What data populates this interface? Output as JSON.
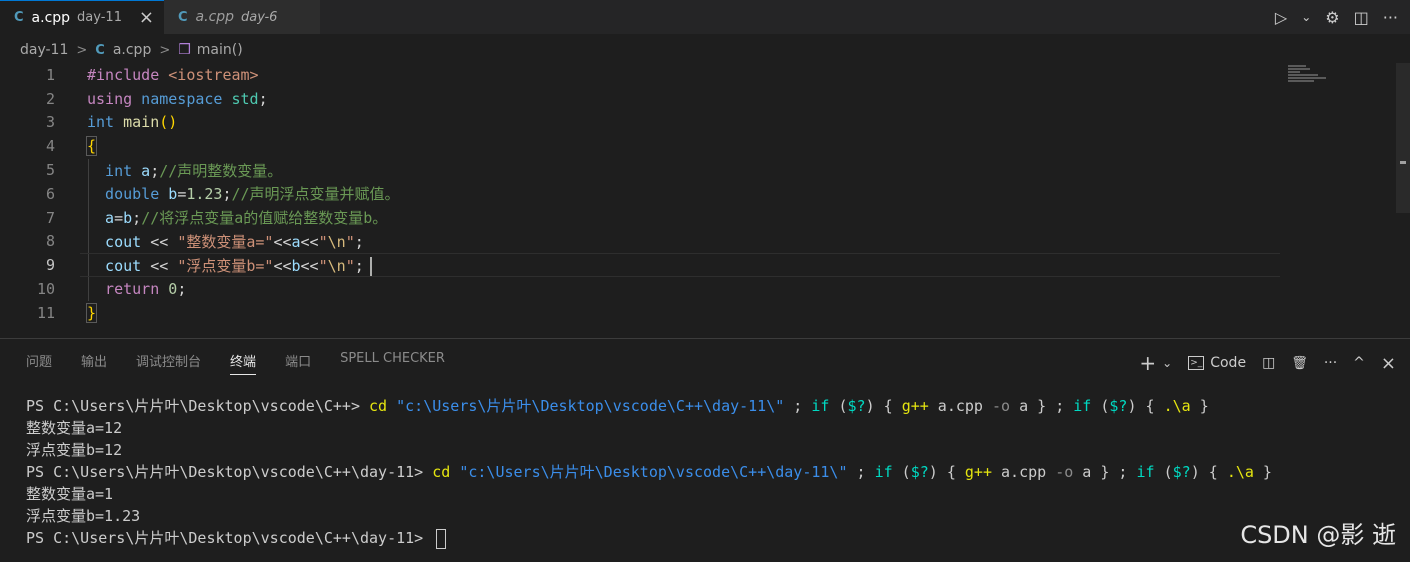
{
  "tabs": [
    {
      "icon": "C",
      "name": "a.cpp",
      "dir": "day-11",
      "close": "×"
    },
    {
      "icon": "C",
      "name": "a.cpp",
      "dir": "day-6"
    }
  ],
  "tab_actions": {
    "run": "▷",
    "run_menu": "⌄",
    "settings": "⚙",
    "split": "◫",
    "more": "···"
  },
  "breadcrumb": {
    "folder": "day-11",
    "file": "a.cpp",
    "symbol": "main()"
  },
  "editor": {
    "line_numbers": [
      "1",
      "2",
      "3",
      "4",
      "5",
      "6",
      "7",
      "8",
      "9",
      "10",
      "11"
    ],
    "current_line": "9",
    "l1": {
      "directive": "#include",
      "header": " <iostream>"
    },
    "l2": {
      "using": "using",
      "namespace": " namespace",
      "std": " std",
      "semi": ";"
    },
    "l3": {
      "type": "int",
      "fn": " main",
      "paren": "()"
    },
    "l4": {
      "brace": "{"
    },
    "l5": {
      "type": "  int",
      "var": " a",
      "semi": ";",
      "comment": "//声明整数变量。"
    },
    "l6": {
      "type": "  double",
      "var": " b",
      "op": "=",
      "num": "1.23",
      "semi": ";",
      "comment": "//声明浮点变量并赋值。"
    },
    "l7": {
      "var": "  a",
      "op": "=",
      "var2": "b",
      "semi": ";",
      "comment": "//将浮点变量a的值赋给整数变量b。"
    },
    "l8": {
      "var": "  cout",
      "op": " << ",
      "str": "\"整数变量a=\"",
      "op2": "<<",
      "var2": "a",
      "op3": "<<",
      "q1": "\"",
      "esc": "\\n",
      "q2": "\"",
      "semi": ";"
    },
    "l9": {
      "var": "  cout",
      "op": " << ",
      "str": "\"浮点变量b=\"",
      "op2": "<<",
      "var2": "b",
      "op3": "<<",
      "q1": "\"",
      "esc": "\\n",
      "q2": "\"",
      "semi": ";"
    },
    "l10": {
      "kw": "  return",
      "num": " 0",
      "semi": ";"
    },
    "l11": {
      "brace": "}"
    }
  },
  "panel": {
    "tabs": [
      "问题",
      "输出",
      "调试控制台",
      "终端",
      "端口",
      "SPELL CHECKER"
    ],
    "active_tab": "终端",
    "actions": {
      "add": "+",
      "add_menu": "⌄",
      "terminal_label": "Code",
      "split": "◫",
      "trash": "🗑",
      "more": "···",
      "maximize": "^",
      "close": "×"
    }
  },
  "terminal": {
    "l1": {
      "prompt": "PS C:\\Users\\片片叶\\Desktop\\vscode\\C++> ",
      "cd": "cd",
      "path": " \"c:\\Users\\片片叶\\Desktop\\vscode\\C++\\day-11\\\"",
      "rest1": " ; ",
      "if1": "if",
      "rest2": " (",
      "q1": "$?",
      "rest3": ") { ",
      "gpp": "g++",
      "rest4": " a.cpp ",
      "flag": "-o",
      "rest5": " a } ; ",
      "if2": "if",
      "rest6": " (",
      "q2": "$?",
      "rest7": ") { ",
      "run": ".\\a",
      "rest8": " }"
    },
    "l2": "整数变量a=12",
    "l3": "浮点变量b=12",
    "l4": {
      "prompt": "PS C:\\Users\\片片叶\\Desktop\\vscode\\C++\\day-11> ",
      "cd": "cd",
      "path": " \"c:\\Users\\片片叶\\Desktop\\vscode\\C++\\day-11\\\"",
      "rest1": " ; ",
      "if1": "if",
      "rest2": " (",
      "q1": "$?",
      "rest3": ") { ",
      "gpp": "g++",
      "rest4": " a.cpp ",
      "flag": "-o",
      "rest5": " a } ; ",
      "if2": "if",
      "rest6": " (",
      "q2": "$?",
      "rest7": ") { ",
      "run": ".\\a",
      "rest8": " }"
    },
    "l5": "整数变量a=1",
    "l6": "浮点变量b=1.23",
    "l7": "PS C:\\Users\\片片叶\\Desktop\\vscode\\C++\\day-11> "
  },
  "watermark": "CSDN @影 逝"
}
